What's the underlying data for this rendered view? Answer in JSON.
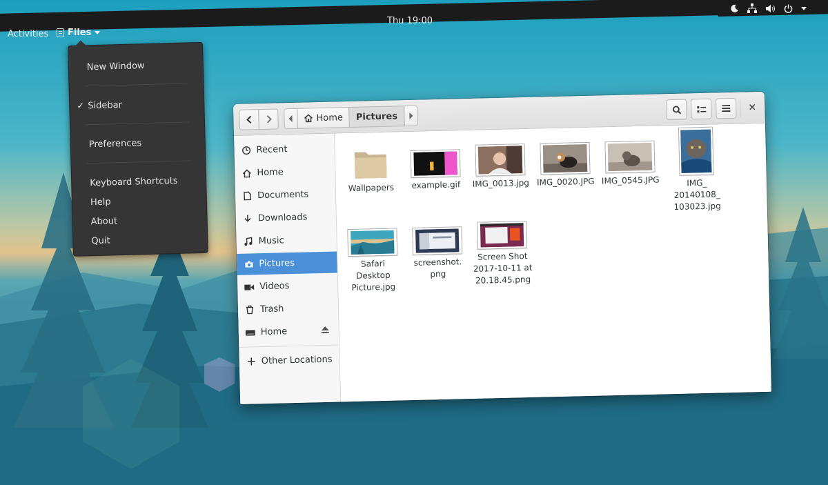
{
  "topbar": {
    "activities": "Activities",
    "app_name": "Files",
    "clock": "Thu 19:00"
  },
  "app_menu": {
    "items": [
      {
        "label": "New Window"
      },
      {
        "label": "Sidebar",
        "checked": true
      },
      {
        "label": "Preferences"
      },
      {
        "label": "Keyboard Shortcuts"
      },
      {
        "label": "Help"
      },
      {
        "label": "About"
      },
      {
        "label": "Quit"
      }
    ],
    "check_glyph": "✓"
  },
  "window": {
    "path": [
      {
        "label": "Home",
        "icon": "home-icon"
      },
      {
        "label": "Pictures"
      }
    ],
    "close_glyph": "✕",
    "sidebar": {
      "items": [
        {
          "label": "Recent",
          "icon": "clock-icon"
        },
        {
          "label": "Home",
          "icon": "home-icon"
        },
        {
          "label": "Documents",
          "icon": "document-icon"
        },
        {
          "label": "Downloads",
          "icon": "download-icon"
        },
        {
          "label": "Music",
          "icon": "music-icon"
        },
        {
          "label": "Pictures",
          "icon": "camera-icon",
          "active": true
        },
        {
          "label": "Videos",
          "icon": "video-icon"
        },
        {
          "label": "Trash",
          "icon": "trash-icon"
        },
        {
          "label": "Home",
          "icon": "drive-icon"
        },
        {
          "label": "Other Locations",
          "icon": "plus-icon"
        }
      ]
    },
    "files": [
      {
        "name": "Wallpapers",
        "type": "folder"
      },
      {
        "name": "example.gif",
        "type": "image"
      },
      {
        "name": "IMG_0013.jpg",
        "type": "image"
      },
      {
        "name": "IMG_0020.JPG",
        "type": "image"
      },
      {
        "name": "IMG_0545.JPG",
        "type": "image"
      },
      {
        "name": "IMG_\n20140108_\n103023.jpg",
        "type": "image"
      },
      {
        "name": "Safari\nDesktop\nPicture.jpg",
        "type": "image"
      },
      {
        "name": "screenshot.\npng",
        "type": "image"
      },
      {
        "name": "Screen Shot\n2017-10-11 at\n20.18.45.png",
        "type": "image"
      }
    ]
  },
  "colors": {
    "accent": "#4a90d9",
    "topbar": "#1b1b1b",
    "menu_bg": "#353535"
  }
}
